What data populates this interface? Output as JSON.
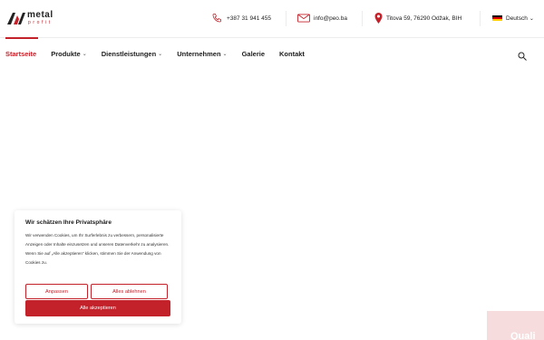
{
  "brand": {
    "name": "metal",
    "sub": "profit",
    "accent": "#c4222b"
  },
  "header": {
    "phone": "+387 31 941 455",
    "email": "info@peo.ba",
    "address": "Titova 59, 76290 Odžak, BIH",
    "language": "Deutsch"
  },
  "nav": {
    "items": [
      {
        "label": "Startseite",
        "dropdown": false,
        "active": true
      },
      {
        "label": "Produkte",
        "dropdown": true,
        "active": false
      },
      {
        "label": "Dienstleistungen",
        "dropdown": true,
        "active": false
      },
      {
        "label": "Unternehmen",
        "dropdown": true,
        "active": false
      },
      {
        "label": "Galerie",
        "dropdown": false,
        "active": false
      },
      {
        "label": "Kontakt",
        "dropdown": false,
        "active": false
      }
    ],
    "chevron": "⌄"
  },
  "cookie": {
    "title": "Wir schätzen Ihre Privatsphäre",
    "text": "Wir verwenden Cookies, um Ihr Surferlebnis zu verbessern, personalisierte Anzeigen oder Inhalte einzusetzen und unseren Datenverkehr zu analysieren. Wenn Sie auf „Alle akzeptieren“ klicken, stimmen Sie der Anwendung von Cookies zu.",
    "customize": "Anpassen",
    "reject": "Alles ablehnen",
    "accept": "Alle akzeptieren"
  },
  "badge": {
    "text": "Quali"
  },
  "icons": {
    "phone": "phone-icon",
    "mail": "mail-icon",
    "pin": "location-pin-icon",
    "flag": "german-flag-icon",
    "search": "search-icon"
  }
}
